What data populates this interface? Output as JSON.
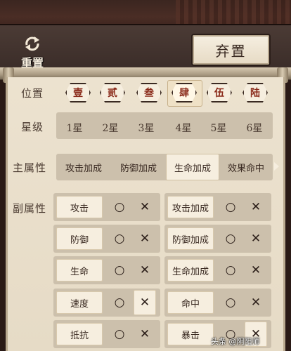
{
  "header": {
    "reset_label": "重置",
    "discard_label": "弃置"
  },
  "position": {
    "label": "位置",
    "items": [
      "壹",
      "贰",
      "叁",
      "肆",
      "伍",
      "陆"
    ],
    "selected_index": 3
  },
  "star_level": {
    "label": "星级",
    "items": [
      "1星",
      "2星",
      "3星",
      "4星",
      "5星",
      "6星"
    ]
  },
  "main_attribute": {
    "label": "主属性",
    "items": [
      "攻击加成",
      "防御加成",
      "生命加成",
      "效果命中"
    ],
    "selected_index": 2
  },
  "sub_attribute": {
    "label": "副属性",
    "o_symbol": "○",
    "x_symbol": "✕",
    "items": [
      {
        "name": "攻击",
        "x_selected": false
      },
      {
        "name": "攻击加成",
        "x_selected": false
      },
      {
        "name": "防御",
        "x_selected": false
      },
      {
        "name": "防御加成",
        "x_selected": false
      },
      {
        "name": "生命",
        "x_selected": false
      },
      {
        "name": "生命加成",
        "x_selected": false
      },
      {
        "name": "速度",
        "x_selected": true
      },
      {
        "name": "命中",
        "x_selected": false
      },
      {
        "name": "抵抗",
        "x_selected": false
      },
      {
        "name": "暴击",
        "x_selected": true
      }
    ]
  },
  "watermark": "头条 @阴阳师"
}
